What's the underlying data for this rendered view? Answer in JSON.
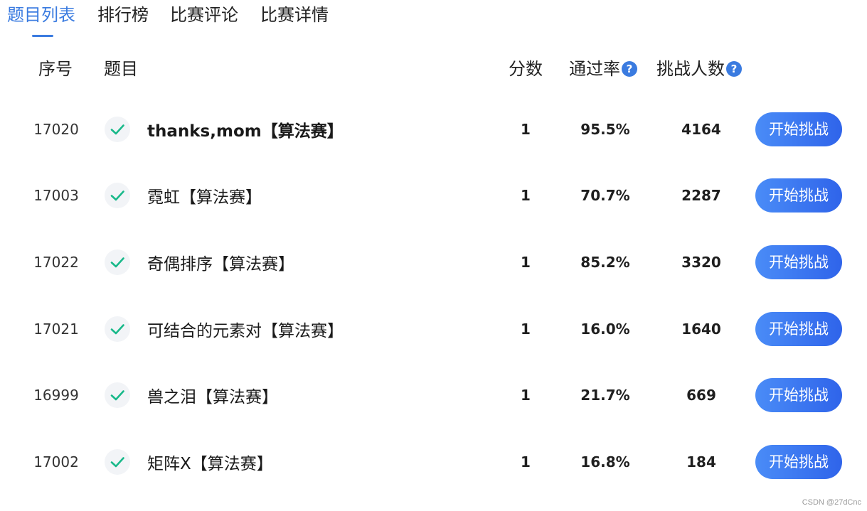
{
  "tabs": [
    {
      "label": "题目列表",
      "active": true
    },
    {
      "label": "排行榜",
      "active": false
    },
    {
      "label": "比赛评论",
      "active": false
    },
    {
      "label": "比赛详情",
      "active": false
    }
  ],
  "header": {
    "id": "序号",
    "title": "题目",
    "score": "分数",
    "pass_rate": "通过率",
    "challengers": "挑战人数",
    "help_glyph": "?"
  },
  "rows": [
    {
      "id": "17020",
      "title": "thanks,mom【算法赛】",
      "score": "1",
      "rate": "95.5%",
      "count": "4164",
      "button": "开始挑战"
    },
    {
      "id": "17003",
      "title": "霓虹【算法赛】",
      "score": "1",
      "rate": "70.7%",
      "count": "2287",
      "button": "开始挑战"
    },
    {
      "id": "17022",
      "title": "奇偶排序【算法赛】",
      "score": "1",
      "rate": "85.2%",
      "count": "3320",
      "button": "开始挑战"
    },
    {
      "id": "17021",
      "title": "可结合的元素对【算法赛】",
      "score": "1",
      "rate": "16.0%",
      "count": "1640",
      "button": "开始挑战"
    },
    {
      "id": "16999",
      "title": "兽之泪【算法赛】",
      "score": "1",
      "rate": "21.7%",
      "count": "669",
      "button": "开始挑战"
    },
    {
      "id": "17002",
      "title": "矩阵X【算法赛】",
      "score": "1",
      "rate": "16.8%",
      "count": "184",
      "button": "开始挑战"
    }
  ],
  "watermark": "CSDN @27dCnc",
  "colors": {
    "accent": "#3a7be0",
    "check": "#19b98a",
    "button_start": "#4a8cf7",
    "button_end": "#2f64ea"
  },
  "icons": {
    "solved": "check-icon",
    "help": "question-circle-icon"
  }
}
